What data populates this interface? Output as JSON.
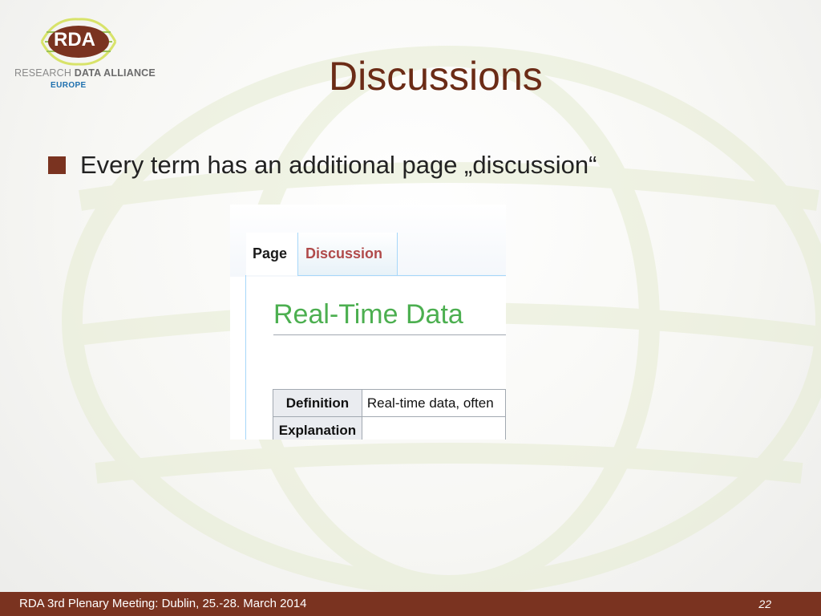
{
  "logo": {
    "badge_text": "RDA",
    "line1_part1": "RESEARCH ",
    "line1_part2": "DATA ALLIANCE",
    "line2": "EUROPE"
  },
  "slide": {
    "title": "Discussions",
    "bullet": "Every term has an additional page „discussion“"
  },
  "screenshot": {
    "tabs": [
      {
        "label": "Page",
        "active": true
      },
      {
        "label": "Discussion",
        "active": false
      }
    ],
    "page_heading": "Real-Time Data",
    "table": [
      {
        "label": "Definition",
        "value": "Real-time data, often"
      },
      {
        "label": "Explanation",
        "value": ""
      }
    ]
  },
  "footer": {
    "text": "RDA 3rd Plenary Meeting: Dublin, 25.-28. March 2014",
    "page_number": "22"
  },
  "colors": {
    "accent_brown": "#7a3320",
    "title_brown": "#6b2b16",
    "heading_green": "#4caf50",
    "discussion_red": "#b04a4a"
  }
}
